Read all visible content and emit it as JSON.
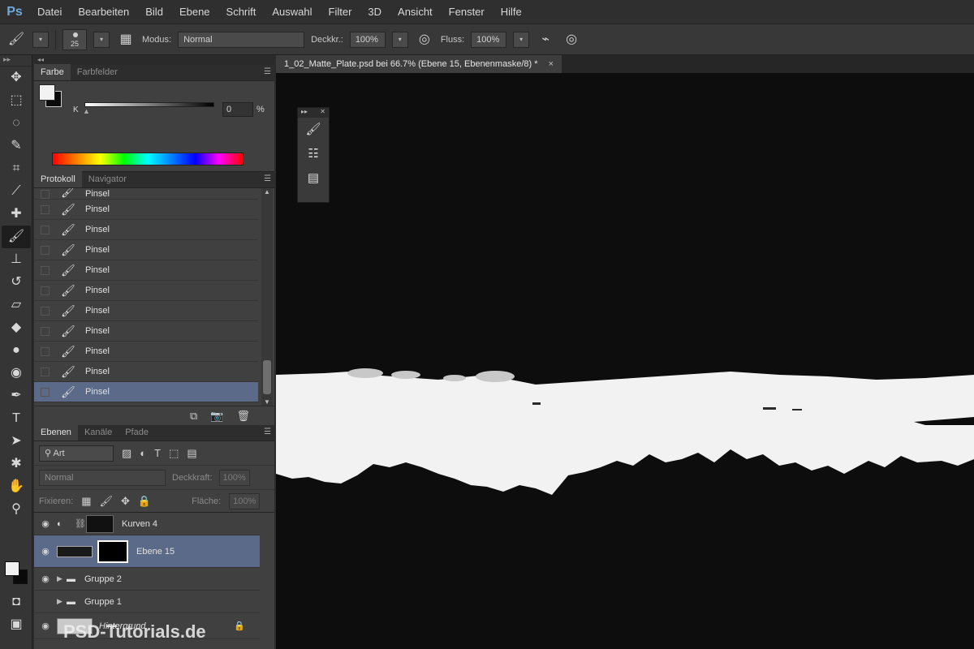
{
  "app": {
    "logo": "Ps"
  },
  "menu": [
    "Datei",
    "Bearbeiten",
    "Bild",
    "Ebene",
    "Schrift",
    "Auswahl",
    "Filter",
    "3D",
    "Ansicht",
    "Fenster",
    "Hilfe"
  ],
  "options": {
    "brush_size": "25",
    "modus_label": "Modus:",
    "modus_value": "Normal",
    "deckkr_label": "Deckkr.:",
    "deckkr_value": "100%",
    "fluss_label": "Fluss:",
    "fluss_value": "100%"
  },
  "color_panel": {
    "tabs": [
      "Farbe",
      "Farbfelder"
    ],
    "channel_label": "K",
    "channel_value": "0",
    "unit": "%"
  },
  "history_panel": {
    "tabs": [
      "Protokoll",
      "Navigator"
    ],
    "top_partial": "Pinsel",
    "items": [
      "Pinsel",
      "Pinsel",
      "Pinsel",
      "Pinsel",
      "Pinsel",
      "Pinsel",
      "Pinsel",
      "Pinsel",
      "Pinsel",
      "Pinsel"
    ]
  },
  "layers_panel": {
    "tabs": [
      "Ebenen",
      "Kanäle",
      "Pfade"
    ],
    "kind": "Art",
    "blend_mode": "Normal",
    "opacity_label": "Deckkraft:",
    "opacity_value": "100%",
    "lock_label": "Fixieren:",
    "fill_label": "Fläche:",
    "fill_value": "100%",
    "layers": [
      {
        "name": "Kurven 4"
      },
      {
        "name": "Ebene 15"
      },
      {
        "name": "Gruppe 2"
      },
      {
        "name": "Gruppe 1"
      },
      {
        "name": "Hintergrund"
      }
    ]
  },
  "document": {
    "tab_title": "1_02_Matte_Plate.psd bei 66.7% (Ebene 15, Ebenenmaske/8) *",
    "close": "×"
  },
  "watermark": "PSD-Tutorials.de",
  "colors": {
    "selection": "#5a6a88",
    "canvas_bg": "#0d0d0d",
    "mask_white": "#f2f2f2"
  }
}
